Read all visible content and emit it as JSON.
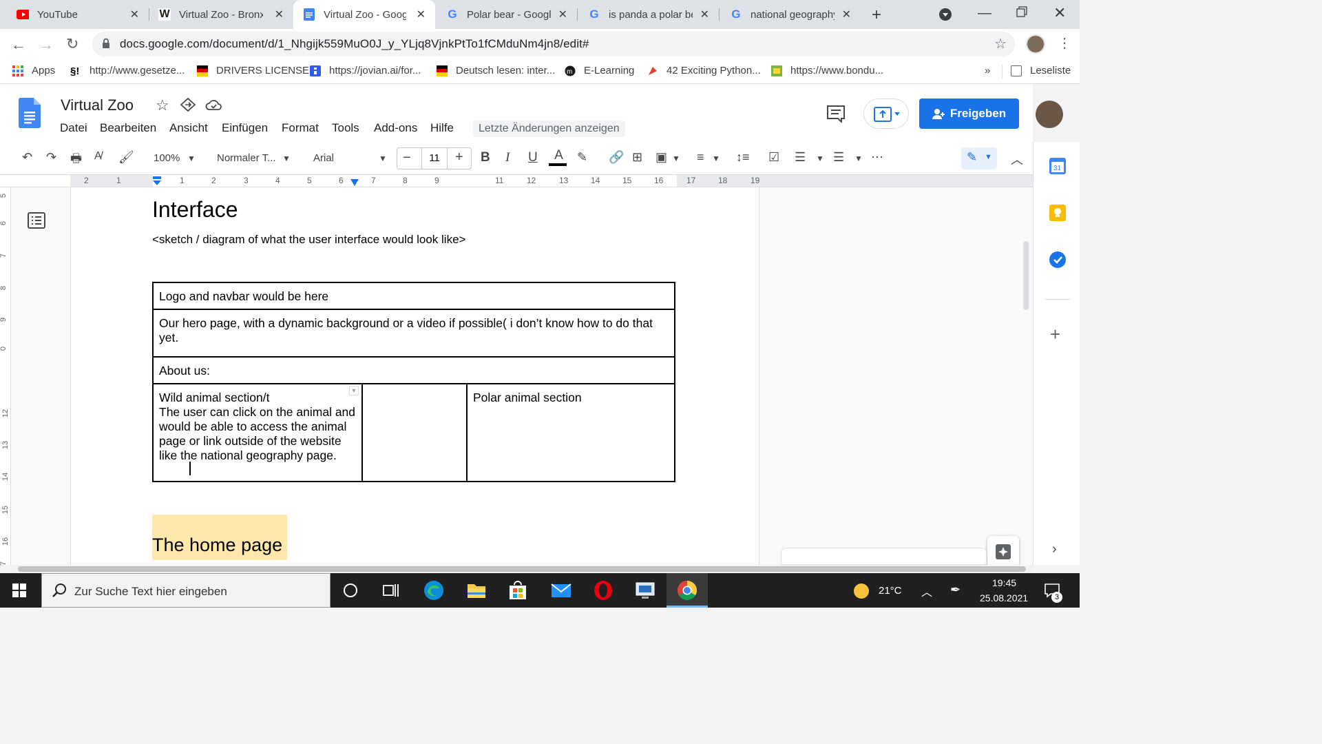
{
  "tabs": [
    {
      "title": "YouTube",
      "icon": "youtube-icon"
    },
    {
      "title": "Virtual Zoo - Bronx",
      "icon": "wix-icon"
    },
    {
      "title": "Virtual Zoo - Google",
      "icon": "docs-icon"
    },
    {
      "title": "Polar bear - Google",
      "icon": "google-icon"
    },
    {
      "title": "is panda a polar bear",
      "icon": "google-icon"
    },
    {
      "title": "national geography",
      "icon": "google-icon"
    }
  ],
  "url": "docs.google.com/document/d/1_Nhgijk559MuO0J_y_YLjq8VjnkPtTo1fCMduNm4jn8/edit#",
  "bookmarks": {
    "apps": "Apps",
    "items": [
      "http://www.gesetze...",
      "DRIVERS LICENSE",
      "https://jovian.ai/for...",
      "Deutsch lesen: inter...",
      "E-Learning",
      "42 Exciting Python...",
      "https://www.bondu..."
    ],
    "more": "»",
    "reading_list": "Leseliste"
  },
  "docs": {
    "title": "Virtual Zoo",
    "menus": [
      "Datei",
      "Bearbeiten",
      "Ansicht",
      "Einfügen",
      "Format",
      "Tools",
      "Add-ons",
      "Hilfe"
    ],
    "last_changes": "Letzte Änderungen anzeigen",
    "share": "Freigeben"
  },
  "toolbar": {
    "zoom": "100%",
    "style": "Normaler T...",
    "font": "Arial",
    "font_size": "11"
  },
  "ruler": [
    "2",
    "1",
    "1",
    "2",
    "3",
    "4",
    "5",
    "6",
    "7",
    "8",
    "9",
    "11",
    "12",
    "13",
    "14",
    "15",
    "16",
    "17",
    "18",
    "19"
  ],
  "vruler": [
    "5",
    "6",
    "7",
    "8",
    "9",
    "0",
    "12",
    "13",
    "14",
    "15",
    "16",
    "7"
  ],
  "document": {
    "heading": "Interface",
    "subtitle": "<sketch / diagram of what the user interface would look like>",
    "table": {
      "row1": "Logo and navbar would be here",
      "row2": "Our hero page, with a dynamic background or a video if possible( i don’t know how to do that yet.",
      "row3": "About us:",
      "cell_wild_title": "Wild animal section/t",
      "cell_wild_body": "The user can click on the animal and would be able to access the animal page or link outside of the website like the national geography page.",
      "cell_middle": "",
      "cell_polar": "Polar animal section"
    },
    "home_heading": "The home page"
  },
  "taskbar": {
    "search_placeholder": "Zur Suche Text hier eingeben",
    "weather": "21°C",
    "time": "19:45",
    "date": "25.08.2021",
    "notifications": "3"
  }
}
